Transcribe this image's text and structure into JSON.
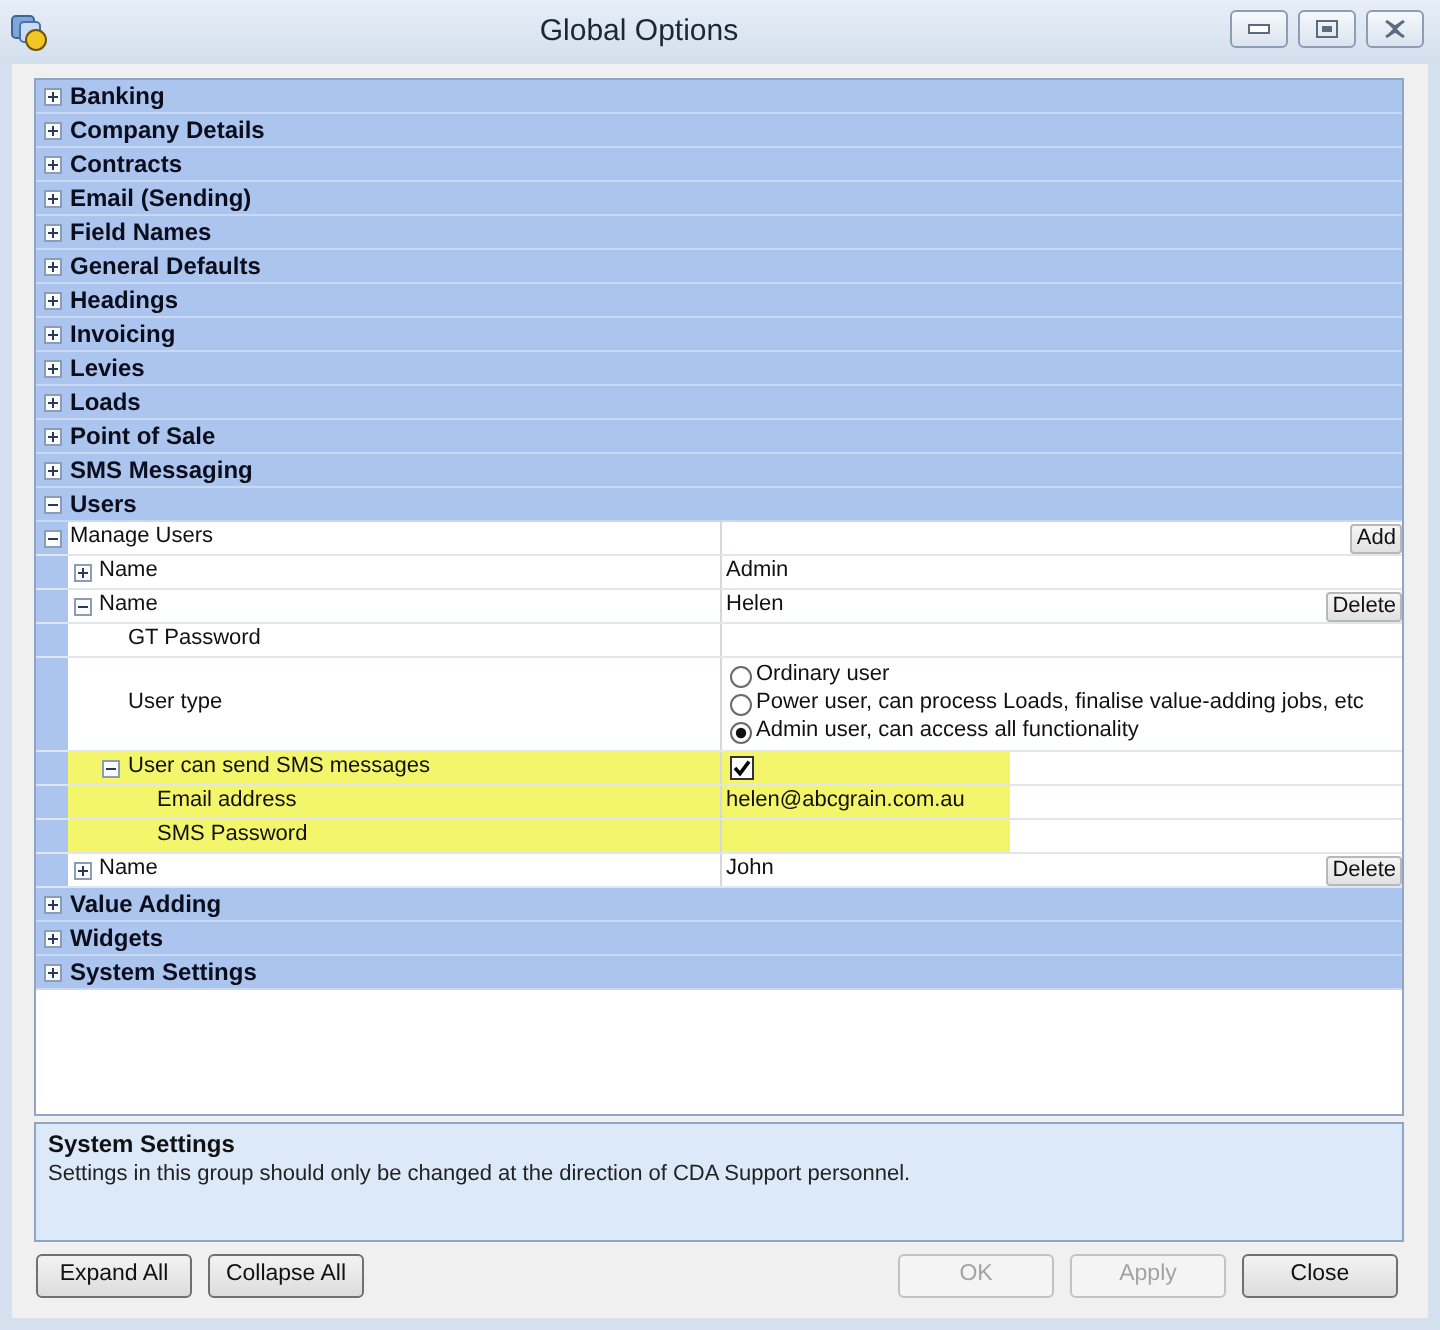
{
  "window": {
    "title": "Global Options"
  },
  "categories": [
    {
      "label": "Banking",
      "expanded": false
    },
    {
      "label": "Company Details",
      "expanded": false
    },
    {
      "label": "Contracts",
      "expanded": false
    },
    {
      "label": "Email (Sending)",
      "expanded": false
    },
    {
      "label": "Field Names",
      "expanded": false
    },
    {
      "label": "General Defaults",
      "expanded": false
    },
    {
      "label": "Headings",
      "expanded": false
    },
    {
      "label": "Invoicing",
      "expanded": false
    },
    {
      "label": "Levies",
      "expanded": false
    },
    {
      "label": "Loads",
      "expanded": false
    },
    {
      "label": "Point of Sale",
      "expanded": false
    },
    {
      "label": "SMS Messaging",
      "expanded": false
    },
    {
      "label": "Users",
      "expanded": true,
      "properties": [
        {
          "label": "Manage Users",
          "kind": "text",
          "expanded": true,
          "button": "Add",
          "children": [
            {
              "label": "Name",
              "kind": "text",
              "value": "Admin",
              "expanded": false
            },
            {
              "label": "Name",
              "kind": "text",
              "value": "Helen",
              "expanded": true,
              "button": "Delete",
              "children": [
                {
                  "label": "GT Password",
                  "kind": "text",
                  "highlighted": false
                },
                {
                  "label": "User type",
                  "kind": "radio",
                  "highlighted": false,
                  "options": [
                    {
                      "label": "Ordinary user",
                      "selected": false
                    },
                    {
                      "label": "Power user, can process Loads, finalise value-adding jobs, etc",
                      "selected": false
                    },
                    {
                      "label": "Admin user, can access all functionality",
                      "selected": true
                    }
                  ]
                },
                {
                  "label": "User can send SMS messages",
                  "kind": "checkbox",
                  "checked": true,
                  "expanded": true,
                  "highlighted": true,
                  "children": [
                    {
                      "label": "Email address",
                      "kind": "text",
                      "value": "helen@abcgrain.com.au",
                      "highlighted": true
                    },
                    {
                      "label": "SMS Password",
                      "kind": "text",
                      "highlighted": true
                    }
                  ]
                }
              ]
            },
            {
              "label": "Name",
              "kind": "text",
              "value": "John",
              "expanded": false,
              "button": "Delete"
            }
          ]
        }
      ]
    },
    {
      "label": "Value Adding",
      "expanded": false
    },
    {
      "label": "Widgets",
      "expanded": false
    },
    {
      "label": "System Settings",
      "expanded": false
    }
  ],
  "description": {
    "title": "System Settings",
    "text": "Settings in this group should only be changed at the direction of CDA Support personnel."
  },
  "footer": {
    "tree_buttons": [
      {
        "label": "Expand All",
        "disabled": false
      },
      {
        "label": "Collapse All",
        "disabled": false
      }
    ],
    "dialog_buttons": [
      {
        "label": "OK",
        "disabled": true
      },
      {
        "label": "Apply",
        "disabled": true
      },
      {
        "label": "Close",
        "disabled": false
      }
    ]
  }
}
